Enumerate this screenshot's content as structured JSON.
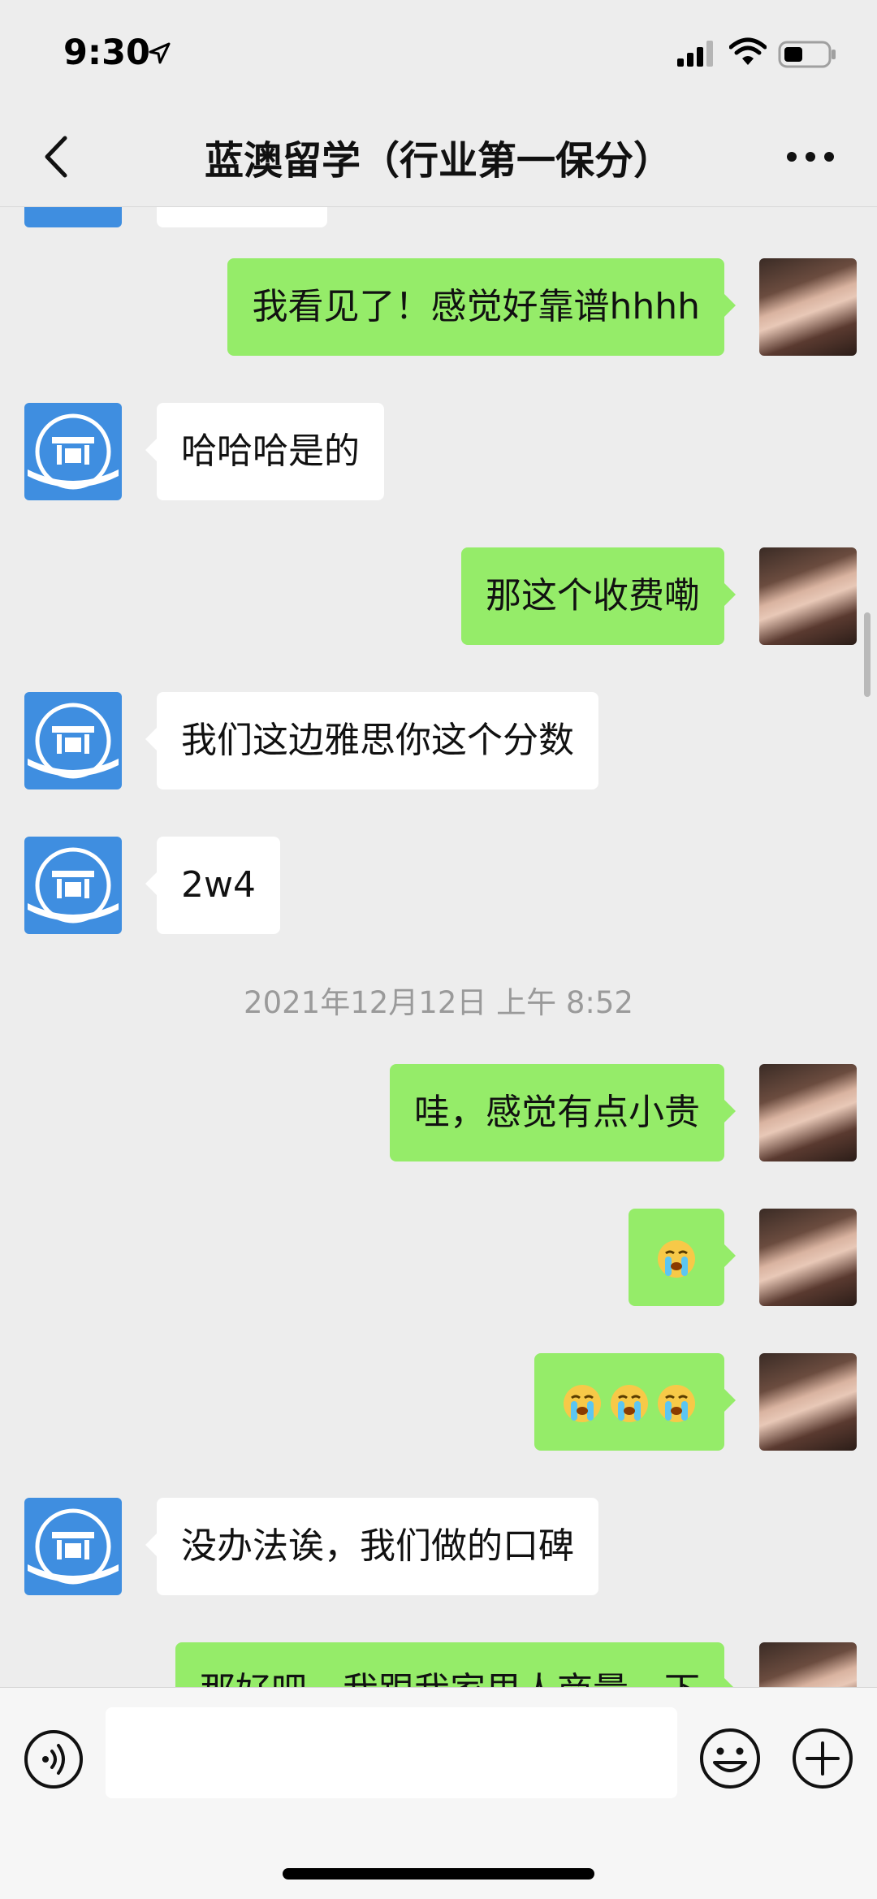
{
  "status_bar": {
    "time": "9:30"
  },
  "nav": {
    "title": "蓝澳留学（行业第一保分）"
  },
  "messages": [
    {
      "side": "out",
      "text": "我看见了！感觉好靠谱hhhh"
    },
    {
      "side": "in",
      "text": "哈哈哈是的"
    },
    {
      "side": "out",
      "text": "那这个收费嘞"
    },
    {
      "side": "in",
      "text": "我们这边雅思你这个分数"
    },
    {
      "side": "in",
      "text": "2w4"
    },
    {
      "timestamp": "2021年12月12日 上午 8:52"
    },
    {
      "side": "out",
      "text": "哇，感觉有点小贵"
    },
    {
      "side": "out",
      "emoji": "crying-emoji",
      "count": 1
    },
    {
      "side": "out",
      "emoji": "crying-emoji",
      "count": 3
    },
    {
      "side": "in",
      "text": "没办法诶，我们做的口碑"
    },
    {
      "side": "out",
      "text": "那好吧，我跟我家里人商量一下"
    }
  ],
  "colors": {
    "outgoing_bubble": "#95ec69",
    "incoming_bubble": "#ffffff",
    "background": "#ededed",
    "avatar_brand": "#3f8ee0"
  },
  "icons": {
    "back": "chevron-left-icon",
    "more": "more-dots-icon",
    "voice": "voice-icon",
    "emoji": "emoji-icon",
    "plus": "plus-icon"
  }
}
